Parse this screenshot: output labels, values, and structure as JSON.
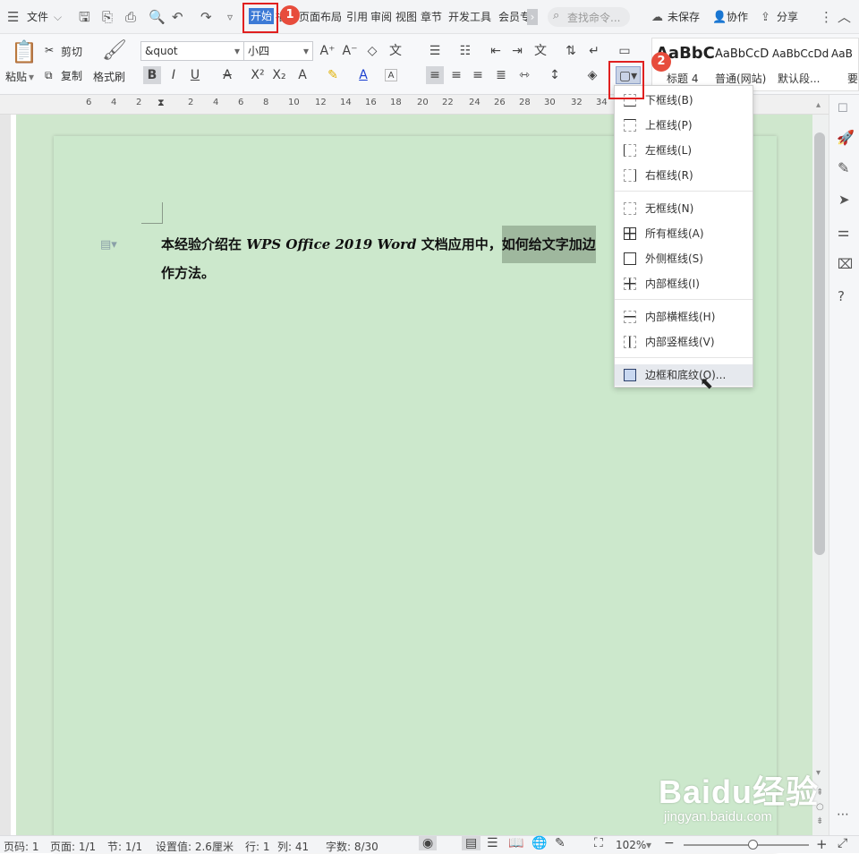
{
  "titlebar": {
    "file_menu": "文件",
    "tabs": [
      "开始",
      "插入",
      "页面布局",
      "引用",
      "审阅",
      "视图",
      "章节",
      "开发工具",
      "会员专"
    ],
    "search_placeholder": "查找命令...",
    "unsaved": "未保存",
    "collaborate": "协作",
    "share": "分享"
  },
  "ribbon": {
    "paste": "粘贴",
    "cut": "剪切",
    "copy": "复制",
    "format_painter": "格式刷",
    "font_name": "&quot",
    "font_size": "小四",
    "styles": [
      {
        "preview": "AaBbC",
        "label": "标题 4"
      },
      {
        "preview": "AaBbCcD",
        "label": "普通(网站)"
      },
      {
        "preview": "AaBbCcDd",
        "label": "默认段..."
      },
      {
        "preview": "AaB",
        "label": "要"
      }
    ]
  },
  "ruler": {
    "ticks": [
      "6",
      "4",
      "2",
      "2",
      "4",
      "6",
      "8",
      "10",
      "12",
      "14",
      "16",
      "18",
      "20",
      "22",
      "24",
      "26",
      "28",
      "30",
      "32",
      "34"
    ]
  },
  "document": {
    "line1_a": "本经验介绍在 ",
    "line1_b": "WPS Office 2019 Word",
    "line1_c": " 文档应用中，",
    "line1_sel": "如何给文字加边",
    "line2": "作方法。"
  },
  "border_menu": {
    "items": [
      {
        "label": "下框线(B)",
        "icon": "border-bottom-icon"
      },
      {
        "label": "上框线(P)",
        "icon": "border-top-icon"
      },
      {
        "label": "左框线(L)",
        "icon": "border-left-icon"
      },
      {
        "label": "右框线(R)",
        "icon": "border-right-icon"
      },
      {
        "label": "无框线(N)",
        "icon": "border-none-icon"
      },
      {
        "label": "所有框线(A)",
        "icon": "border-all-icon"
      },
      {
        "label": "外侧框线(S)",
        "icon": "border-outside-icon"
      },
      {
        "label": "内部框线(I)",
        "icon": "border-inside-icon"
      },
      {
        "label": "内部横框线(H)",
        "icon": "border-inside-horizontal-icon"
      },
      {
        "label": "内部竖框线(V)",
        "icon": "border-inside-vertical-icon"
      },
      {
        "label": "边框和底纹(O)...",
        "icon": "borders-shading-icon"
      }
    ]
  },
  "annotations": {
    "step1": "1",
    "step2": "2"
  },
  "statusbar": {
    "page_num": "页码: 1",
    "pages": "页面: 1/1",
    "section": "节: 1/1",
    "setting": "设置值: 2.6厘米",
    "row": "行: 1",
    "col": "列: 41",
    "wordcount": "字数: 8/30",
    "zoom": "102%",
    "zoom_level": 0.55
  },
  "watermark": {
    "brand": "Baidu经验",
    "url": "jingyan.baidu.com"
  },
  "colors": {
    "active_tab": "#3c7ad6",
    "highlight_red": "#e02020",
    "badge": "#e74c3c",
    "page_bg": "#cce8cc"
  }
}
